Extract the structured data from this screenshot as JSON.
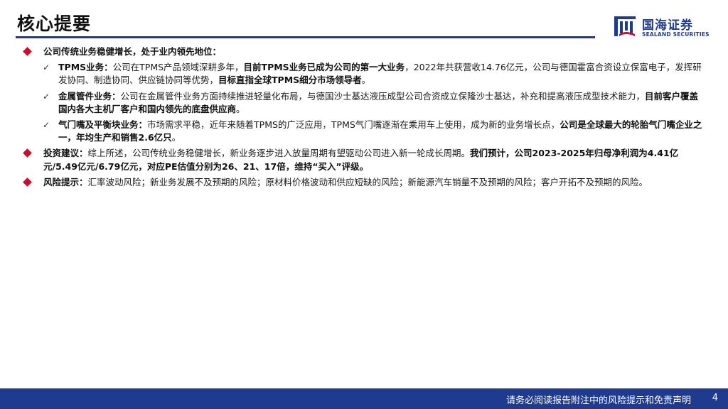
{
  "page": {
    "title": "核心提要",
    "page_number": "4"
  },
  "brand": {
    "name_cn": "国海证券",
    "name_en": "SEALAND SECURITIES",
    "primary_color": "#1f3b8f",
    "bullet_color": "#c8102e"
  },
  "sections": {
    "s1": {
      "label": "公司传统业务稳健增长，处于业内领先地位："
    },
    "sub1": {
      "label": "TPMS业务：",
      "t1": "公司在TPMS产品领域深耕多年，",
      "b1": "目前TPMS业务已成为公司的第一大业务",
      "t2": "，2022年共获营收14.76亿元，公司与德国霍富合资设立保富电子，发挥研发协同、制造协同、供应链协同等优势，",
      "b2": "目标直指全球TPMS细分市场领导者",
      "t3": "。"
    },
    "sub2": {
      "label": "金属管件业务：",
      "t1": "公司在金属管件业务方面持续推进轻量化布局，与德国沙士基达液压成型公司合资成立保隆沙士基达，补充和提高液压成型技术能力，",
      "b1": "目前客户覆盖国内各大主机厂客户和国内领先的底盘供应商",
      "t2": "。"
    },
    "sub3": {
      "label": "气门嘴及平衡块业务：",
      "t1": "市场需求平稳，近年来随着TPMS的广泛应用，TPMS气门嘴逐渐在乘用车上使用，成为新的业务增长点，",
      "b1": "公司是全球最大的轮胎气门嘴企业之一，年均生产和销售2.6亿只",
      "t2": "。"
    },
    "s2": {
      "label": "投资建议：",
      "t1": "综上所述，公司传统业务稳健增长，新业务逐步进入放量周期有望驱动公司进入新一轮成长周期。",
      "b1": "我们预计，公司2023-2025年归母净利润为4.41亿元/5.49亿元/6.79亿元，对应PE估值分别为26、21、17倍，维持“买入”评级。"
    },
    "s3": {
      "label": "风险提示：",
      "t1": "汇率波动风险；新业务发展不及预期的风险；原材料价格波动和供应短缺的风险；新能源汽车销量不及预期的风险；客户开拓不及预期的风险。"
    }
  },
  "footer": {
    "disclaimer": "请务必阅读报告附注中的风险提示和免责声明"
  }
}
